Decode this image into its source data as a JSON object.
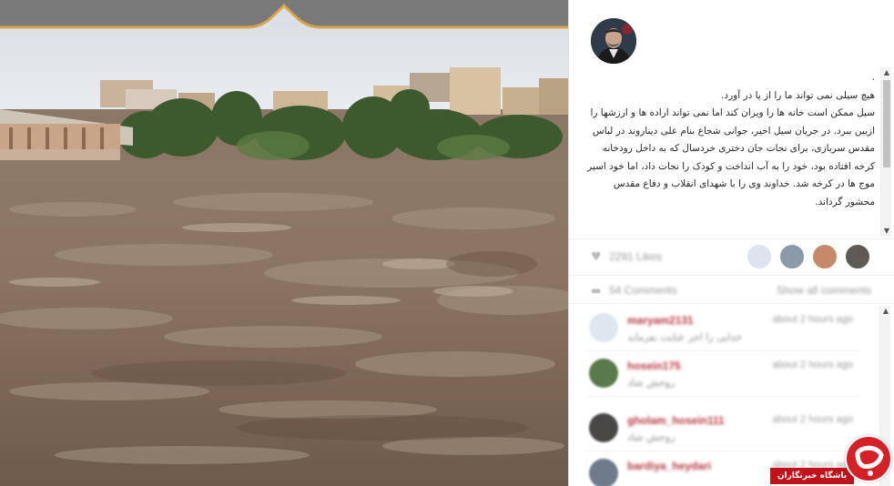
{
  "post": {
    "caption_lines": [
      ".",
      "هیچ سیلی نمی تواند ما را از پا در آورد.",
      "سیل ممکن است خانه ها را ویران کند اما نمی تواند اراده ها و ارزشها را ازبین ببرد. در جریان سیل اخیر، جوانی شجاع بنام علی دیناروند در لباس مقدس سربازی، برای نجات جان دختری خردسال که به داخل رودخانه کرخه افتاده بود، خود را به آب انداخت و کودک را نجات داد، اما خود اسیر موج ها در کرخه شد. خداوند وی را با شهدای انقلاب و دفاع مقدس محشور گرداند."
    ],
    "likes_label": "2291 Likes",
    "comments_label": "54 Comments",
    "show_all_label": "Show all comments",
    "comments": [
      {
        "user": "maryam2131",
        "time": "about 2 hours ago",
        "text": "خدایی را اجر عنایت بفرماید",
        "avatar_color": "#dfe6ef"
      },
      {
        "user": "hosein175",
        "time": "about 2 hours ago",
        "text": "روحش شاد",
        "avatar_color": "#5b7a4c"
      },
      {
        "user": "gholam_hosein111",
        "time": "about 2 hours ago",
        "text": "روحش شاد",
        "avatar_color": "#4a4845"
      },
      {
        "user": "bardiya_heydari",
        "time": "about 2 hours ago",
        "text": "",
        "avatar_color": "#6d7b8a"
      }
    ]
  },
  "watermark": {
    "label": "باشگاه خبرنگاران",
    "logo_letter": "ج"
  },
  "colors": {
    "username": "#b5363f",
    "watermark_red": "#d42026",
    "frame_gold": "#d8a64a"
  },
  "icons": {
    "heart": "heart-icon",
    "comment": "comment-icon",
    "scroll_up": "scroll-up-arrow-icon",
    "scroll_down": "scroll-down-arrow-icon"
  }
}
